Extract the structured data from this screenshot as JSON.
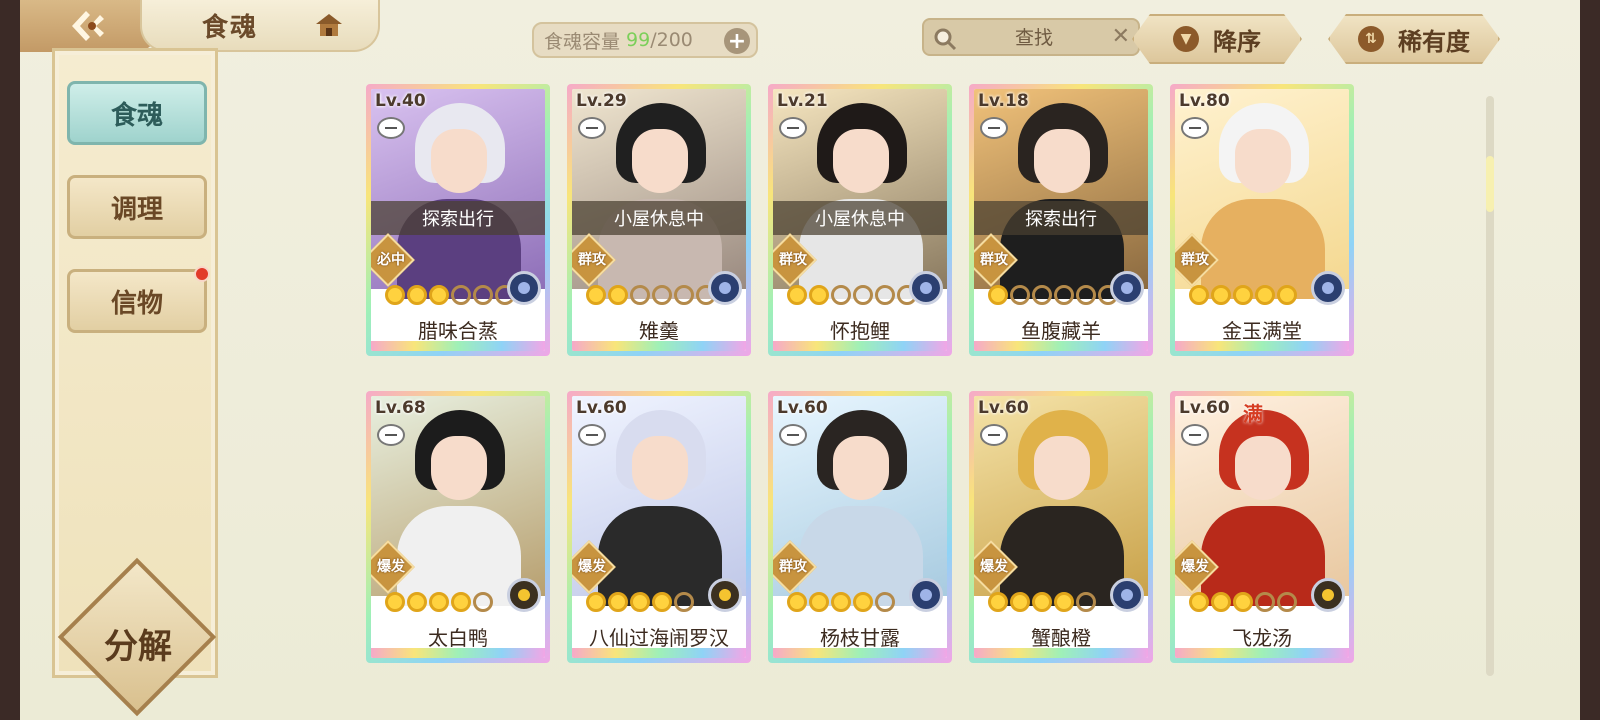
{
  "header": {
    "title": "食魂",
    "capacity_label": "食魂容量",
    "capacity_current": "99",
    "capacity_max": "/200",
    "search_placeholder": "查找",
    "sort_order_label": "降序",
    "sort_key_label": "稀有度"
  },
  "sidebar": {
    "items": [
      {
        "label": "食魂",
        "active": true
      },
      {
        "label": "调理",
        "active": false
      },
      {
        "label": "信物",
        "active": false,
        "notification": true
      }
    ],
    "decompose_label": "分解"
  },
  "cards": [
    {
      "level": "Lv.40",
      "name": "腊味合蒸",
      "status": "探索出行",
      "role": "必中",
      "stars": 3,
      "max": 6,
      "flavor": "blue"
    },
    {
      "level": "Lv.29",
      "name": "雉羹",
      "status": "小屋休息中",
      "role": "群攻",
      "stars": 2,
      "max": 6,
      "flavor": "blue"
    },
    {
      "level": "Lv.21",
      "name": "怀抱鲤",
      "status": "小屋休息中",
      "role": "群攻",
      "stars": 2,
      "max": 6,
      "flavor": "blue"
    },
    {
      "level": "Lv.18",
      "name": "鱼腹藏羊",
      "status": "探索出行",
      "role": "群攻",
      "stars": 1,
      "max": 6,
      "flavor": "blue"
    },
    {
      "level": "Lv.80",
      "name": "金玉满堂",
      "status": "",
      "role": "群攻",
      "stars": 5,
      "max": 5,
      "flavor": "blue"
    },
    {
      "level": "Lv.68",
      "name": "太白鸭",
      "status": "",
      "role": "爆发",
      "stars": 4,
      "max": 5,
      "flavor": "gold"
    },
    {
      "level": "Lv.60",
      "name": "八仙过海闹罗汉",
      "status": "",
      "role": "爆发",
      "stars": 4,
      "max": 5,
      "flavor": "gold"
    },
    {
      "level": "Lv.60",
      "name": "杨枝甘露",
      "status": "",
      "role": "群攻",
      "stars": 4,
      "max": 5,
      "flavor": "blue"
    },
    {
      "level": "Lv.60",
      "name": "蟹酿橙",
      "status": "",
      "role": "爆发",
      "stars": 4,
      "max": 5,
      "flavor": "blue"
    },
    {
      "level": "Lv.60",
      "name": "飞龙汤",
      "status": "",
      "role": "爆发",
      "stars": 3,
      "max": 5,
      "flavor": "gold",
      "badge": "满"
    }
  ]
}
